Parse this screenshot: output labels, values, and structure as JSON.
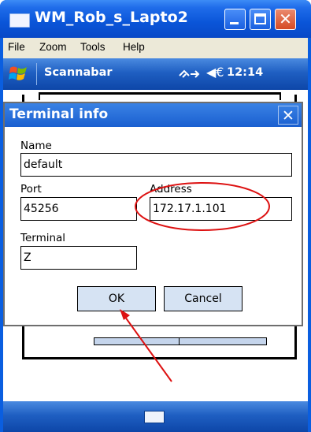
{
  "window": {
    "title": "WM_Rob_s_Lapto2",
    "controls": [
      "minimize-icon",
      "maximize-icon",
      "close-icon"
    ]
  },
  "menubar": {
    "items": [
      "File",
      "Zoom",
      "Tools",
      "Help"
    ]
  },
  "navbar": {
    "app_title": "Scannabar",
    "status_icon": "connectivity-icon",
    "volume_glyph": "◀€",
    "time": "12:14"
  },
  "dialog": {
    "title": "Terminal info",
    "close_glyph": "✕",
    "name_label": "Name",
    "name_value": "default",
    "port_label": "Port",
    "port_value": "45256",
    "address_label": "Address",
    "address_value": "172.17.1.101",
    "terminal_label": "Terminal",
    "terminal_value": "Z",
    "ok_label": "OK",
    "cancel_label": "Cancel"
  },
  "annotations": {
    "highlight_color": "#dd1111",
    "arrow_color": "#dd1111"
  },
  "colors": {
    "xp_title": "#0a55d8",
    "wm_bar": "#1f5fc2",
    "button_fill": "#d6e3f3"
  }
}
